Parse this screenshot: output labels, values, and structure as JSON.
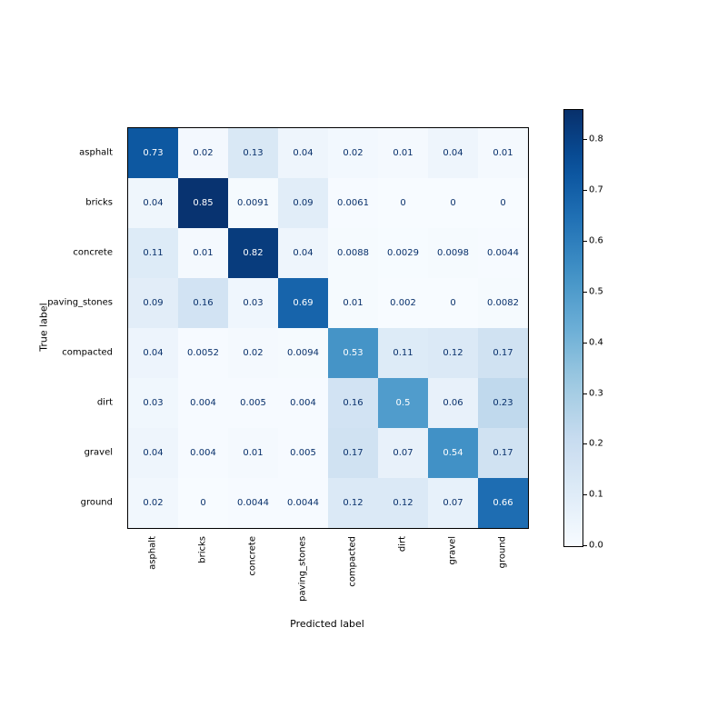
{
  "chart_data": {
    "type": "heatmap",
    "xlabel": "Predicted label",
    "ylabel": "True label",
    "categories": [
      "asphalt",
      "bricks",
      "concrete",
      "paving_stones",
      "compacted",
      "dirt",
      "gravel",
      "ground"
    ],
    "matrix": [
      [
        0.73,
        0.017,
        0.13,
        0.037,
        0.02,
        0.013,
        0.039,
        0.014
      ],
      [
        0.036,
        0.85,
        0.0091,
        0.094,
        0.0061,
        0,
        0,
        0
      ],
      [
        0.11,
        0.012,
        0.82,
        0.038,
        0.0088,
        0.0029,
        0.0098,
        0.0044
      ],
      [
        0.092,
        0.16,
        0.033,
        0.69,
        0.01,
        0.002,
        0,
        0.0082
      ],
      [
        0.044,
        0.0052,
        0.015,
        0.0094,
        0.53,
        0.11,
        0.12,
        0.17
      ],
      [
        0.03,
        0.004,
        0.005,
        0.004,
        0.16,
        0.5,
        0.064,
        0.23
      ],
      [
        0.037,
        0.004,
        0.011,
        0.005,
        0.17,
        0.065,
        0.54,
        0.17
      ],
      [
        0.024,
        0,
        0.0044,
        0.0044,
        0.12,
        0.12,
        0.068,
        0.66
      ]
    ],
    "vmin": 0.0,
    "vmax": 0.86,
    "cbar_ticks": [
      0.0,
      0.1,
      0.2,
      0.3,
      0.4,
      0.5,
      0.6,
      0.7,
      0.8
    ],
    "text_format_threshold": 0.01,
    "text_color_threshold": 0.43,
    "colors": {
      "annotation_dark": "#08306b",
      "annotation_light": "#ffffff"
    }
  }
}
